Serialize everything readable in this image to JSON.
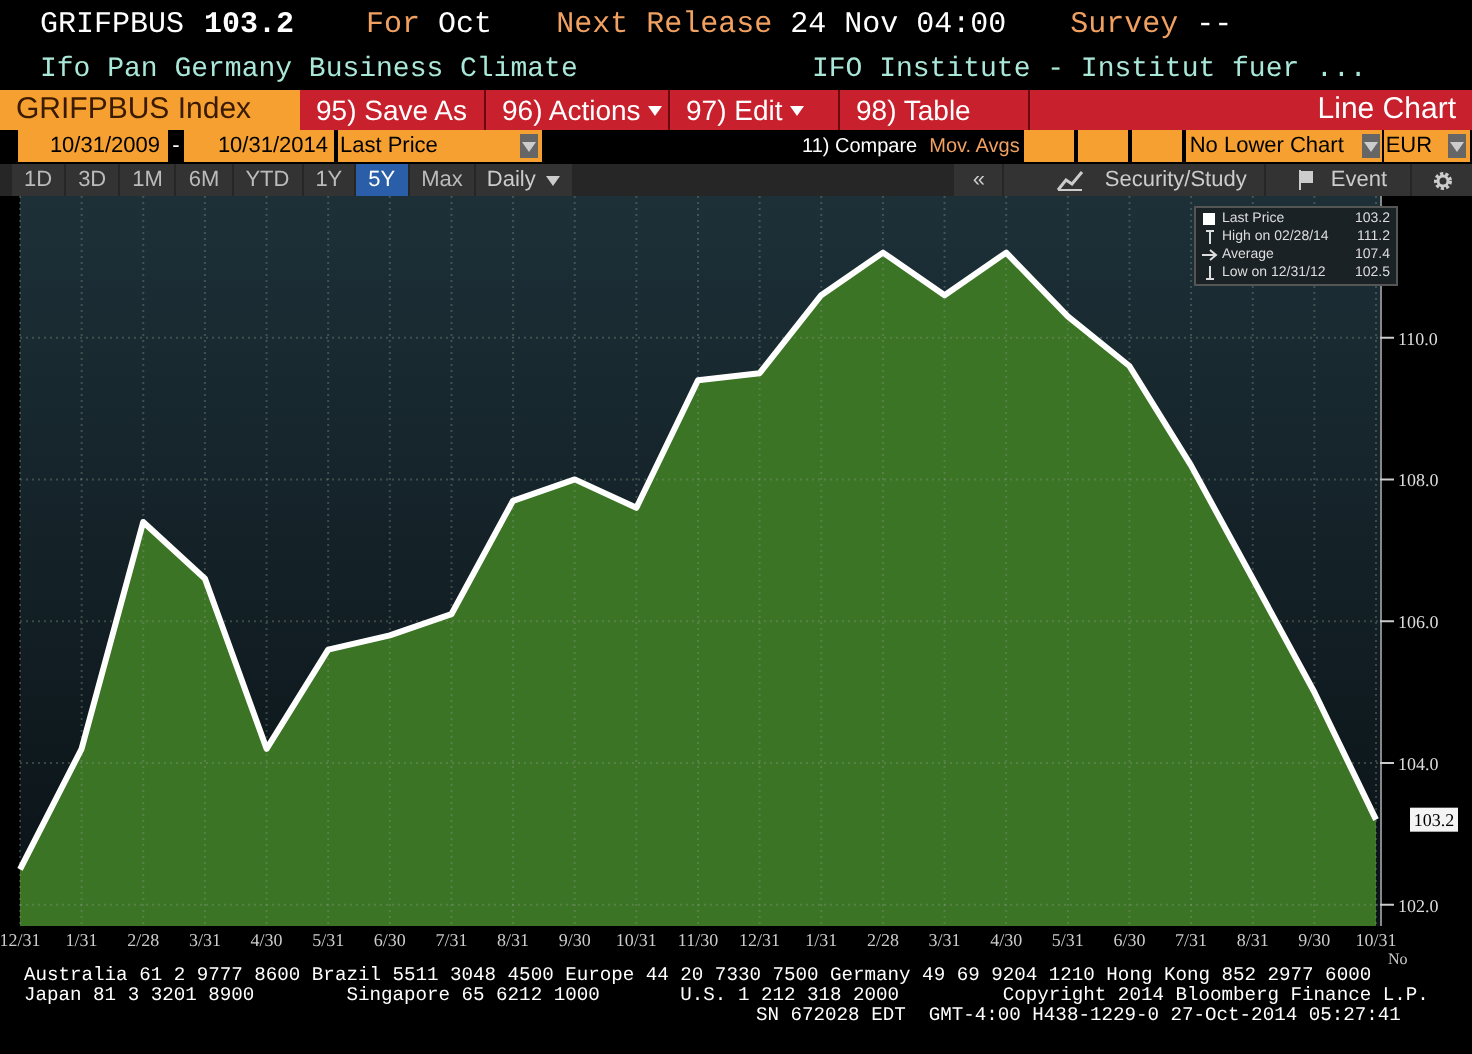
{
  "header": {
    "ticker": "GRIFPBUS",
    "value": "103.2",
    "for_label": "For",
    "for_value": "Oct",
    "release_label": "Next Release",
    "release_value": "24 Nov 04:00",
    "survey_label": "Survey",
    "survey_value": "--",
    "name": "Ifo Pan Germany Business Climate",
    "source": "IFO Institute - Institut fuer ..."
  },
  "toolbar": {
    "security": "GRIFPBUS Index",
    "buttons": [
      {
        "number": "95)",
        "label": "Save As",
        "dropdown": false
      },
      {
        "number": "96)",
        "label": "Actions",
        "dropdown": true
      },
      {
        "number": "97)",
        "label": "Edit",
        "dropdown": true
      },
      {
        "number": "98)",
        "label": "Table",
        "dropdown": false
      }
    ],
    "chart_type": "Line Chart"
  },
  "range": {
    "start": "10/31/2009",
    "separator": "-",
    "end": "10/31/2014",
    "field": "Last Price",
    "compare": "11) Compare",
    "mov_avgs": "Mov. Avgs",
    "lower_chart": "No Lower Chart",
    "currency": "EUR"
  },
  "periods": [
    {
      "label": "1D",
      "selected": false
    },
    {
      "label": "3D",
      "selected": false
    },
    {
      "label": "1M",
      "selected": false
    },
    {
      "label": "6M",
      "selected": false
    },
    {
      "label": "YTD",
      "selected": false
    },
    {
      "label": "1Y",
      "selected": false
    },
    {
      "label": "5Y",
      "selected": true
    },
    {
      "label": "Max",
      "selected": false
    }
  ],
  "frequency": "Daily",
  "tools": {
    "collapse": "«",
    "study": "Security/Study",
    "event": "Event"
  },
  "legend": [
    {
      "kind": "last",
      "value": "103.2"
    },
    {
      "kind": "high",
      "label": "High on 02/28/14",
      "value": "111.2"
    },
    {
      "kind": "average",
      "label": "Average",
      "value": "107.4"
    },
    {
      "kind": "low",
      "label": "Low on 12/31/12",
      "value": "102.5"
    }
  ],
  "last_value_tag": "103.2",
  "axis_cut_label": "No",
  "chart_data": {
    "type": "area",
    "categories": [
      "12/31",
      "1/31",
      "2/28",
      "3/31",
      "4/30",
      "5/31",
      "6/30",
      "7/31",
      "8/31",
      "9/30",
      "10/31",
      "11/30",
      "12/31",
      "1/31",
      "2/28",
      "3/31",
      "4/30",
      "5/31",
      "6/30",
      "7/31",
      "8/31",
      "9/30",
      "10/31"
    ],
    "grid": true,
    "series": [
      {
        "name": "Last Price",
        "color": "#3b7424",
        "values": [
          102.5,
          104.2,
          107.4,
          106.6,
          104.2,
          105.6,
          105.8,
          106.1,
          107.7,
          108.0,
          107.6,
          109.4,
          109.5,
          110.6,
          111.2,
          110.6,
          111.2,
          110.3,
          109.6,
          108.2,
          106.6,
          105.0,
          103.2
        ]
      }
    ],
    "ylim": [
      101.7,
      112.0
    ],
    "yticks": [
      {
        "value": 102,
        "label": "102.0"
      },
      {
        "value": 104,
        "label": "104.0"
      },
      {
        "value": 106,
        "label": "106.0"
      },
      {
        "value": 108,
        "label": "108.0"
      },
      {
        "value": 110,
        "label": "110.0"
      }
    ]
  },
  "footer": [
    "Australia 61 2 9777 8600 Brazil 5511 3048 4500 Europe 44 20 7330 7500 Germany 49 69 9204 1210 Hong Kong 852 2977 6000",
    "Japan 81 3 3201 8900        Singapore 65 6212 1000       U.S. 1 212 318 2000         Copyright 2014 Bloomberg Finance L.P.",
    "SN 672028 EDT  GMT-4:00 H438-1229-0 27-Oct-2014 05:27:41"
  ]
}
